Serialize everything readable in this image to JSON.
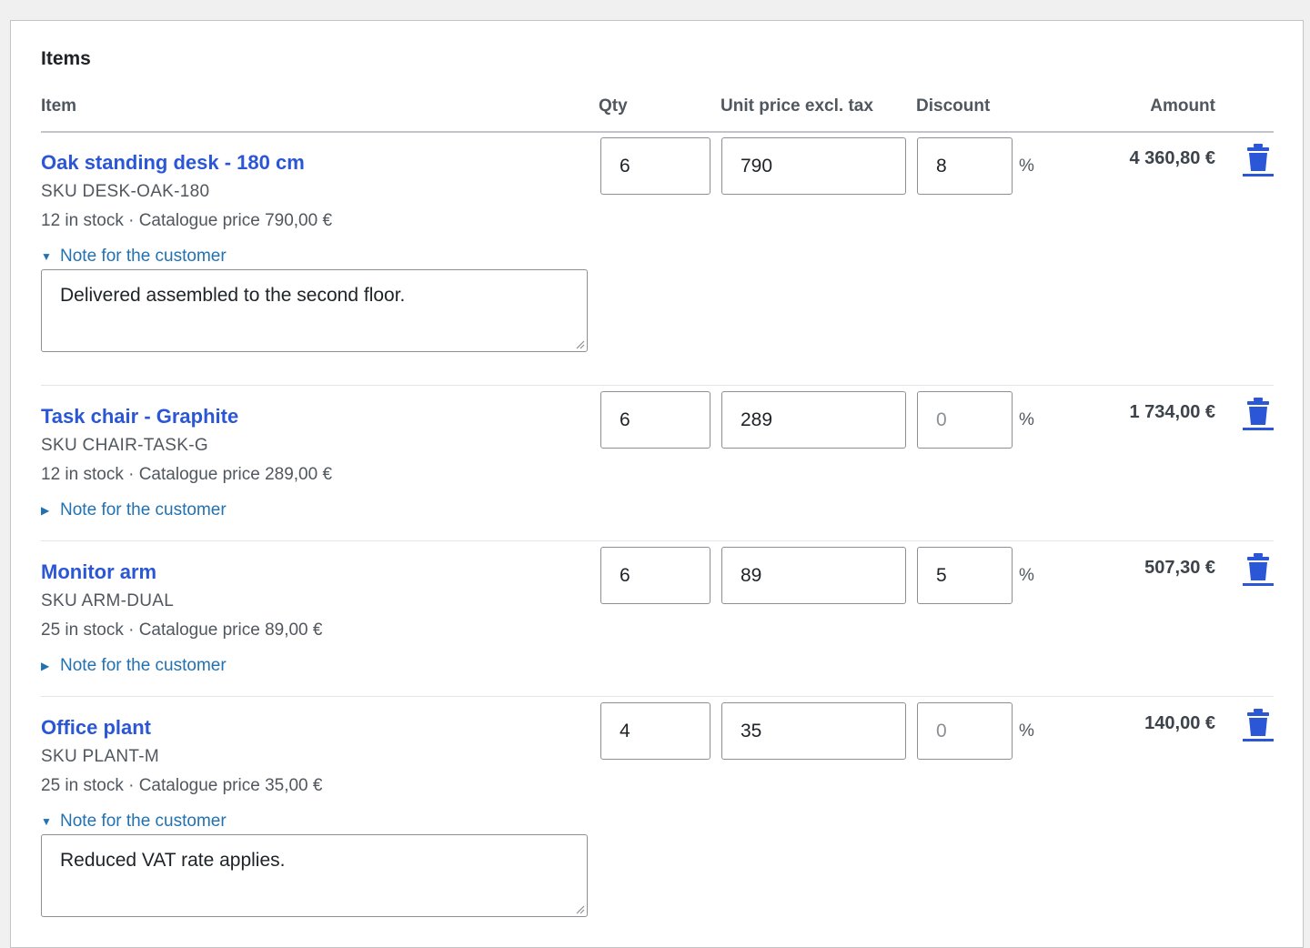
{
  "section": {
    "title": "Items"
  },
  "columns": {
    "item": "Item",
    "qty": "Qty",
    "unit_price": "Unit price excl. tax",
    "discount": "Discount",
    "amount": "Amount"
  },
  "colors": {
    "link": "#2b56d6",
    "note_link": "#2271b1",
    "trash": "#2b56d6"
  },
  "items": [
    {
      "name": "Oak standing desk - 180 cm",
      "sku": "SKU DESK-OAK-180",
      "stock": "12 in stock · Catalogue price 790,00 €",
      "qty": "6",
      "unit_price": "790",
      "discount": "8",
      "discount_placeholder": false,
      "percent_sign": "%",
      "amount": "4 360,80 €",
      "note_label": "Note for the customer",
      "note_open": true,
      "note_text": "Delivered assembled to the second floor.",
      "delete_icon": "trash-icon"
    },
    {
      "name": "Task chair - Graphite",
      "sku": "SKU CHAIR-TASK-G",
      "stock": "12 in stock · Catalogue price 289,00 €",
      "qty": "6",
      "unit_price": "289",
      "discount": "0",
      "discount_placeholder": true,
      "percent_sign": "%",
      "amount": "1 734,00 €",
      "note_label": "Note for the customer",
      "note_open": false,
      "note_text": "",
      "delete_icon": "trash-icon"
    },
    {
      "name": "Monitor arm",
      "sku": "SKU ARM-DUAL",
      "stock": "25 in stock · Catalogue price 89,00 €",
      "qty": "6",
      "unit_price": "89",
      "discount": "5",
      "discount_placeholder": false,
      "percent_sign": "%",
      "amount": "507,30 €",
      "note_label": "Note for the customer",
      "note_open": false,
      "note_text": "",
      "delete_icon": "trash-icon"
    },
    {
      "name": "Office plant",
      "sku": "SKU PLANT-M",
      "stock": "25 in stock · Catalogue price 35,00 €",
      "qty": "4",
      "unit_price": "35",
      "discount": "0",
      "discount_placeholder": true,
      "percent_sign": "%",
      "amount": "140,00 €",
      "note_label": "Note for the customer",
      "note_open": true,
      "note_text": "Reduced VAT rate applies.",
      "delete_icon": "trash-icon"
    }
  ]
}
